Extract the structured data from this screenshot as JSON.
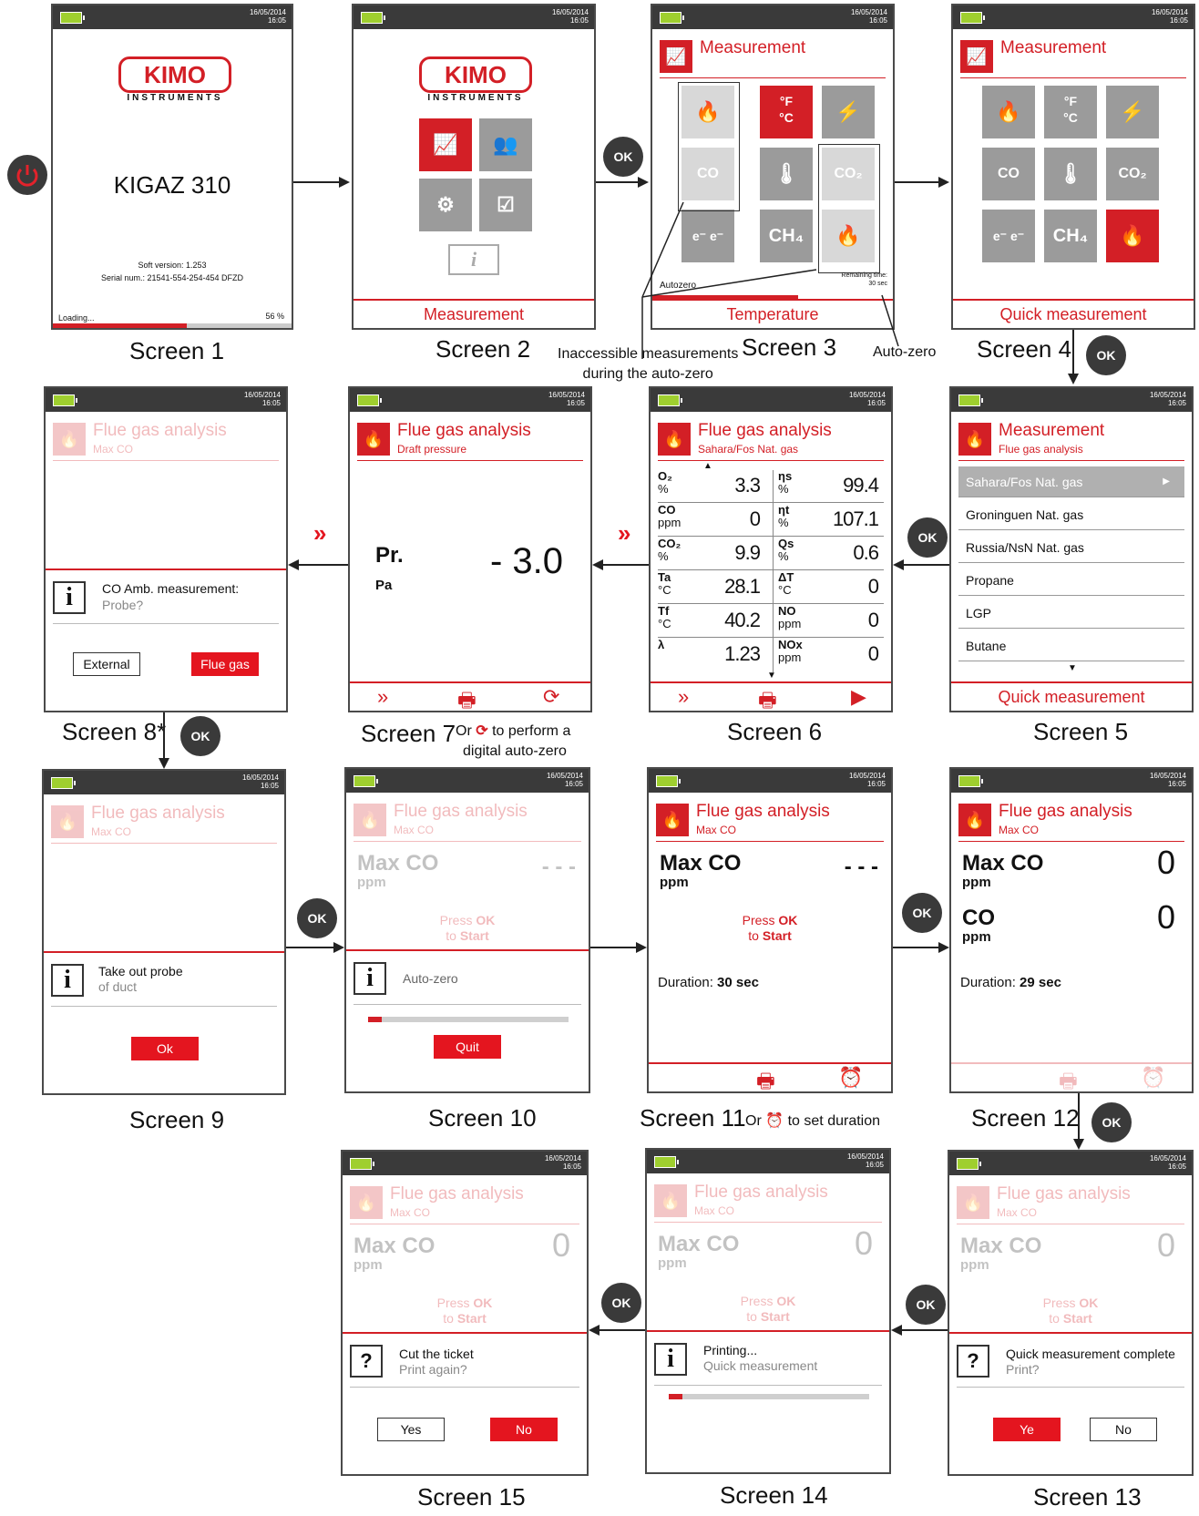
{
  "status": {
    "date": "16/05/2014",
    "time": "16:05"
  },
  "kimo": {
    "logo": "KIMO",
    "sub": "INSTRUMENTS"
  },
  "power_icon": "power-icon",
  "screen1": {
    "model": "KIGAZ 310",
    "soft": "Soft version: 1.253",
    "serial": "Serial num.: 21541-554-254-454 DFZD",
    "loading": "Loading...",
    "pct": "56 %",
    "progress": 0.56
  },
  "screen2": {
    "footer": "Measurement",
    "info_icon": "i"
  },
  "screen3": {
    "title": "Measurement",
    "fahr": "°F",
    "cels": "°C",
    "co": "CO",
    "co2": "CO₂",
    "ch4": "CH₄",
    "autozero": "Autozero",
    "remaining": "Remaining time:",
    "remaining_val": "30 sec",
    "footer": "Temperature"
  },
  "screen4": {
    "title": "Measurement",
    "footer": "Quick measurement"
  },
  "screen5": {
    "title": "Measurement",
    "sub": "Flue gas analysis",
    "items": [
      "Sahara/Fos Nat. gas",
      "Groninguen Nat. gas",
      "Russia/NsN Nat. gas",
      "Propane",
      "LGP",
      "Butane"
    ],
    "footer": "Quick measurement"
  },
  "screen6": {
    "title": "Flue gas analysis",
    "sub": "Sahara/Fos Nat. gas",
    "rows": [
      {
        "l1": "O₂",
        "l2": "%",
        "v1": "3.3",
        "r1": "ηs",
        "r2": "%",
        "v2": "99.4"
      },
      {
        "l1": "CO",
        "l2": "ppm",
        "v1": "0",
        "r1": "ηt",
        "r2": "%",
        "v2": "107.1"
      },
      {
        "l1": "CO₂",
        "l2": "%",
        "v1": "9.9",
        "r1": "Qs",
        "r2": "%",
        "v2": "0.6"
      },
      {
        "l1": "Ta",
        "l2": "°C",
        "v1": "28.1",
        "r1": "ΔT",
        "r2": "°C",
        "v2": "0"
      },
      {
        "l1": "Tf",
        "l2": "°C",
        "v1": "40.2",
        "r1": "NO",
        "r2": "ppm",
        "v2": "0"
      },
      {
        "l1": "λ",
        "l2": "",
        "v1": "1.23",
        "r1": "NOx",
        "r2": "ppm",
        "v2": "0"
      }
    ]
  },
  "screen7": {
    "title": "Flue gas analysis",
    "sub": "Draft pressure",
    "label": "Pr.",
    "unit": "Pa",
    "value": "- 3.0"
  },
  "screen8": {
    "title": "Flue gas analysis",
    "sub": "Max CO",
    "msg1": "CO Amb. measurement:",
    "msg2": "Probe?",
    "btn1": "External",
    "btn2": "Flue gas"
  },
  "screen9": {
    "title": "Flue gas analysis",
    "sub": "Max CO",
    "msg1": "Take out probe",
    "msg2": "of duct",
    "btn": "Ok"
  },
  "screen10": {
    "title": "Flue gas analysis",
    "sub": "Max CO",
    "label": "Max CO",
    "unit": "ppm",
    "value": "- - -",
    "press1": "Press ",
    "ok": "OK",
    "press2": "to ",
    "start": "Start",
    "msg": "Auto-zero",
    "btn": "Quit",
    "progress": 0.07
  },
  "screen11": {
    "title": "Flue gas analysis",
    "sub": "Max CO",
    "label": "Max CO",
    "unit": "ppm",
    "value": "- - -",
    "press1": "Press ",
    "ok": "OK",
    "press2": "to ",
    "start": "Start",
    "duration_l": "Duration: ",
    "duration_v": "30 sec"
  },
  "screen12": {
    "title": "Flue gas analysis",
    "sub": "Max CO",
    "label": "Max CO",
    "unit": "ppm",
    "value": "0",
    "label2": "CO",
    "unit2": "ppm",
    "value2": "0",
    "duration_l": "Duration: ",
    "duration_v": "29 sec"
  },
  "screen13": {
    "title": "Flue gas analysis",
    "sub": "Max CO",
    "label": "Max CO",
    "unit": "ppm",
    "value": "0",
    "press1": "Press ",
    "ok": "OK",
    "press2": "to ",
    "start": "Start",
    "msg1": "Quick measurement complete",
    "msg2": "Print?",
    "btn1": "Ye",
    "btn2": "No"
  },
  "screen14": {
    "title": "Flue gas analysis",
    "sub": "Max CO",
    "label": "Max CO",
    "unit": "ppm",
    "value": "0",
    "press1": "Press ",
    "ok": "OK",
    "press2": "to ",
    "start": "Start",
    "msg1": "Printing...",
    "msg2": "Quick measurement",
    "progress": 0.07
  },
  "screen15": {
    "title": "Flue gas analysis",
    "sub": "Max CO",
    "label": "Max CO",
    "unit": "ppm",
    "value": "0",
    "press1": "Press ",
    "ok": "OK",
    "press2": "to ",
    "start": "Start",
    "msg1": "Cut the ticket",
    "msg2": "Print again?",
    "btn1": "Yes",
    "btn2": "No"
  },
  "captions": [
    "Screen 1",
    "Screen 2",
    "Screen 3",
    "Screen 4",
    "Screen 5",
    "Screen 6",
    "Screen 7",
    "Screen 8*",
    "Screen 9",
    "Screen 10",
    "Screen 11",
    "Screen 12",
    "Screen 13",
    "Screen 14",
    "Screen 15"
  ],
  "ok_label": "OK",
  "notes": {
    "inaccessible1": "Inaccessible measurements",
    "inaccessible2": "during the auto-zero",
    "autozero": "Auto-zero",
    "s7_or": "Or",
    "s7_rest": "to perform a",
    "s7_line2": "digital auto-zero",
    "s11_or": "Or",
    "s11_rest": "to set duration"
  },
  "colors": {
    "accent": "#d31f26",
    "bar": "#3a3a3a",
    "tile_grey": "#9b9b9b",
    "battery": "#9fcf2f"
  }
}
